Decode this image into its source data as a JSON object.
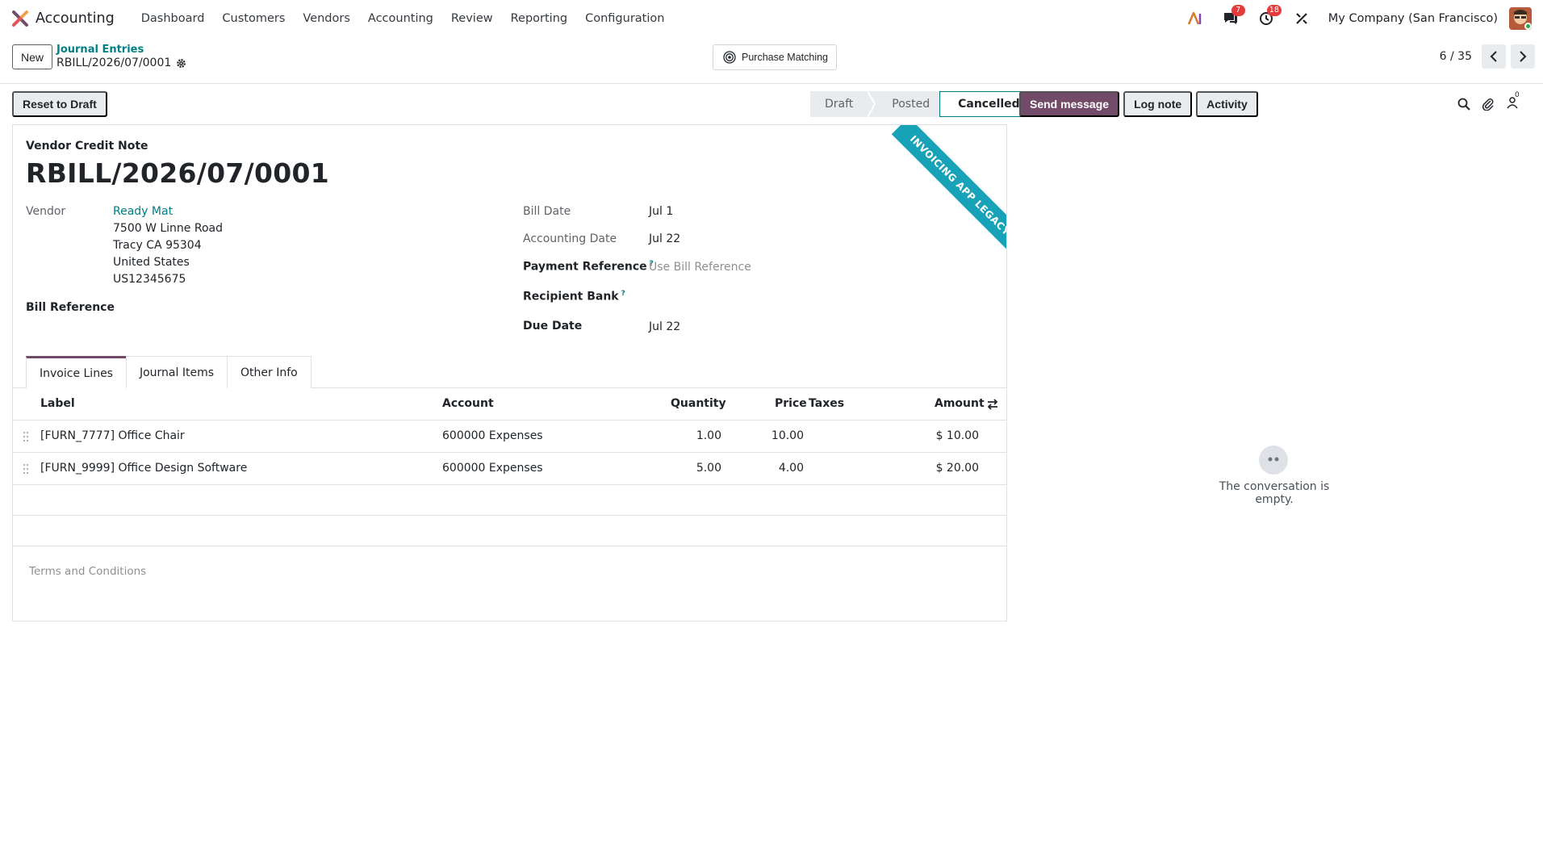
{
  "navbar": {
    "app_name": "Accounting",
    "menu": [
      "Dashboard",
      "Customers",
      "Vendors",
      "Accounting",
      "Review",
      "Reporting",
      "Configuration"
    ],
    "messages_badge": "7",
    "activities_badge": "18",
    "company": "My Company (San Francisco)"
  },
  "control_panel": {
    "new_label": "New",
    "breadcrumb_parent": "Journal Entries",
    "breadcrumb_current": "RBILL/2026/07/0001",
    "purchase_matching_label": "Purchase Matching",
    "pager_value": "6 / 35"
  },
  "statusbar": {
    "reset_label": "Reset to Draft",
    "steps": [
      "Draft",
      "Posted",
      "Cancelled"
    ],
    "current_step": "Cancelled"
  },
  "form": {
    "ribbon": "INVOICING APP LEGACY",
    "doc_type": "Vendor Credit Note",
    "doc_name": "RBILL/2026/07/0001",
    "vendor_label": "Vendor",
    "vendor_name": "Ready Mat",
    "vendor_address": [
      "7500 W Linne Road",
      "Tracy CA 95304",
      "United States",
      "US12345675"
    ],
    "bill_reference_label": "Bill Reference",
    "bill_date_label": "Bill Date",
    "bill_date": "Jul 1",
    "accounting_date_label": "Accounting Date",
    "accounting_date": "Jul 22",
    "payment_reference_label": "Payment Reference",
    "payment_reference_placeholder": "Use Bill Reference",
    "recipient_bank_label": "Recipient Bank",
    "due_date_label": "Due Date",
    "due_date": "Jul 22",
    "help_mark": "?",
    "tabs": [
      "Invoice Lines",
      "Journal Items",
      "Other Info"
    ],
    "columns": {
      "label": "Label",
      "account": "Account",
      "quantity": "Quantity",
      "price": "Price",
      "taxes": "Taxes",
      "amount": "Amount"
    },
    "lines": [
      {
        "label": "[FURN_7777] Office Chair",
        "account": "600000 Expenses",
        "quantity": "1.00",
        "price": "10.00",
        "taxes": "",
        "amount": "$ 10.00"
      },
      {
        "label": "[FURN_9999] Office Design Software",
        "account": "600000 Expenses",
        "quantity": "5.00",
        "price": "4.00",
        "taxes": "",
        "amount": "$ 20.00"
      }
    ],
    "terms_placeholder": "Terms and Conditions"
  },
  "chatter": {
    "send_message": "Send message",
    "log_note": "Log note",
    "activity": "Activity",
    "followers_count": "0",
    "empty_text": "The conversation is empty."
  },
  "colors": {
    "brand": "#714b67",
    "link": "#017e84",
    "ribbon": "#17a2b8",
    "badge": "#e43b3b"
  }
}
